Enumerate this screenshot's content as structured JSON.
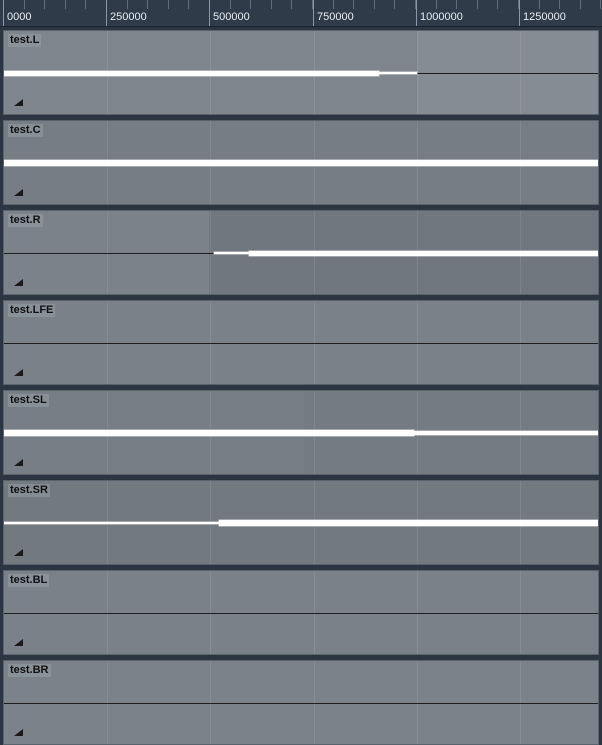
{
  "ruler": {
    "labels": [
      "0000",
      "250000",
      "500000",
      "750000",
      "1000000",
      "1250000"
    ]
  },
  "tracks": [
    {
      "name": "test.L"
    },
    {
      "name": "test.C"
    },
    {
      "name": "test.R"
    },
    {
      "name": "test.LFE"
    },
    {
      "name": "test.SL"
    },
    {
      "name": "test.SR"
    },
    {
      "name": "test.BL"
    },
    {
      "name": "test.BR"
    }
  ],
  "colors": {
    "track_bg_light": "#7c838b",
    "track_bg_dark": "#6c737b",
    "waveform": "#ffffff",
    "ruler_bg": "#2f3b48"
  }
}
